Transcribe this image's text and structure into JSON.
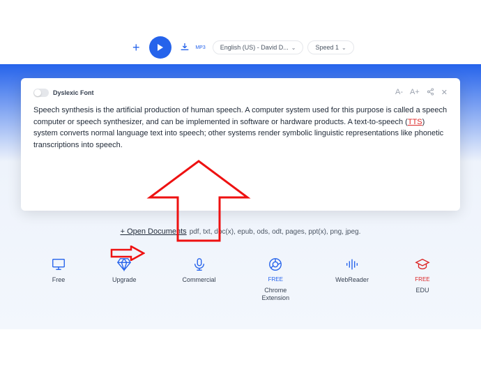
{
  "toolbar": {
    "voice_select": "English (US) - David D...",
    "speed_select": "Speed 1",
    "download_label": "MP3"
  },
  "card": {
    "dyslexic_label": "Dyslexic Font",
    "font_dec": "A-",
    "font_inc": "A+",
    "text_1": "Speech synthesis is the artificial production of human speech. A computer system used for this purpose is called a speech computer or speech synthesizer, and can be implemented in software or hardware products. A text-to-speech (",
    "tts": "TTS",
    "text_2": ") system converts normal language text into speech; other systems render symbolic linguistic representations like phonetic transcriptions into speech."
  },
  "open": {
    "plus": "+",
    "label": " Open Documents",
    "formats": " pdf, txt, doc(x), epub, ods, odt, pages, ppt(x), png, jpeg."
  },
  "features": [
    {
      "label": "Free",
      "sub": ""
    },
    {
      "label": "Upgrade",
      "sub": ""
    },
    {
      "label": "Commercial",
      "sub": ""
    },
    {
      "label": "Chrome\nExtension",
      "sub": "FREE"
    },
    {
      "label": "WebReader",
      "sub": ""
    },
    {
      "label": "EDU",
      "sub": "FREE"
    }
  ]
}
